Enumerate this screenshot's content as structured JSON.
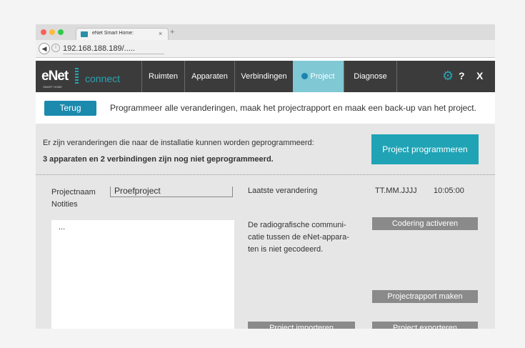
{
  "browser": {
    "tab_title": "eNet Smart Home:",
    "tab_close": "×",
    "new_tab": "+",
    "back": "◀",
    "info": "i",
    "url": "192.168.188.189/....."
  },
  "nav": {
    "logo": "eNet",
    "logo_sub": "connect",
    "logo_tag": "SMART HOME",
    "items": [
      "Ruimten",
      "Apparaten",
      "Verbindingen",
      "Project",
      "Diagnose"
    ],
    "active": "Project",
    "help": "?",
    "close": "X"
  },
  "infobar": {
    "back_label": "Terug",
    "text": "Programmeer alle veranderingen, maak het projectrapport en maak een back-up van het project."
  },
  "changes": {
    "text": "Er zijn veranderingen die naar de installatie kunnen worden geprogrammeerd:",
    "bold": "3 apparaten en 2 verbindingen zijn nog niet geprogrammeerd.",
    "program_button": "Project programmeren"
  },
  "project": {
    "name_label": "Projectnaam",
    "name_value": "Proefproject",
    "notes_label": "Notities",
    "notes_value": "...",
    "last_change_label": "Laatste verandering",
    "date": "TT.MM.JJJJ",
    "time": "10:05:00",
    "radio_line1": "De radiografische communi-",
    "radio_line2": "catie tussen de eNet-appara-",
    "radio_line3": "ten is niet gecodeerd.",
    "encode_button": "Codering activeren",
    "report_button": "Projectrapport maken",
    "import_button": "Project importeren",
    "export_button": "Project exporteren"
  },
  "colors": {
    "accent": "#1fa3b5",
    "active_tab": "#7fc8d4",
    "nav_bg": "#3b3b3b",
    "gray_button": "#8a8a8a"
  }
}
